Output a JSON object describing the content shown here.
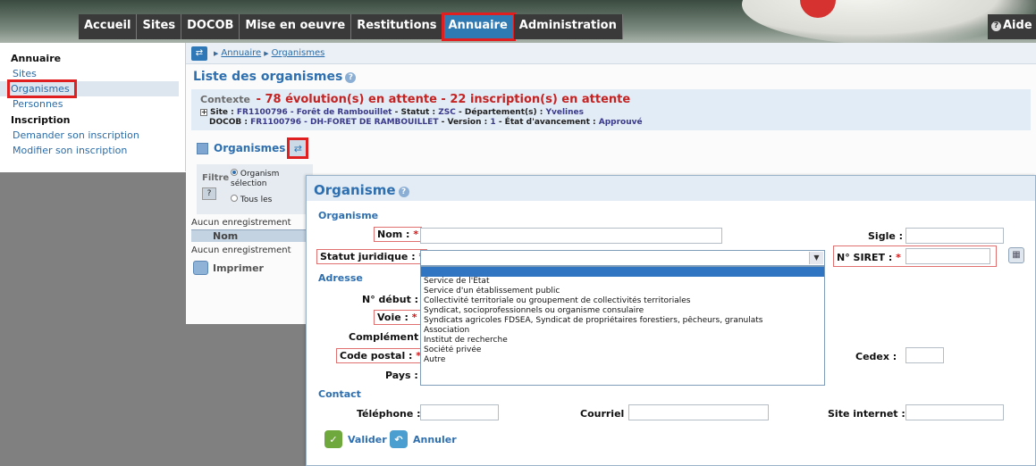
{
  "topnav": {
    "items": [
      "Accueil",
      "Sites",
      "DOCOB",
      "Mise en oeuvre",
      "Restitutions",
      "Annuaire",
      "Administration"
    ],
    "active": "Annuaire",
    "help_label": "Aide"
  },
  "sidebar": {
    "group1": "Annuaire",
    "sites": "Sites",
    "organismes": "Organismes",
    "personnes": "Personnes",
    "group2": "Inscription",
    "demander": "Demander son inscription",
    "modifier": "Modifier son inscription"
  },
  "breadcrumb": [
    "Annuaire",
    "Organismes"
  ],
  "page_title": "Liste des organismes",
  "context": {
    "label": "Contexte",
    "summary": "- 78 évolution(s) en attente - 22 inscription(s) en attente",
    "site_label": "Site :",
    "site_value": "FR1100796 - Forêt de Rambouillet",
    "statut_label": "- Statut :",
    "statut_value": "ZSC",
    "dept_label": "- Département(s) :",
    "dept_value": "Yvelines",
    "docob_label": "DOCOB :",
    "docob_value": "FR1100796 - DH-FORET DE RAMBOUILLET",
    "version_label": "- Version :",
    "version_value": "1",
    "etat_label": "- État d'avancement :",
    "etat_value": "Approuvé"
  },
  "section": {
    "title": "Organismes",
    "filter_label": "Filtre",
    "filter_opt1": "Organism sélection",
    "filter_opt2": "Tous les",
    "no_record_1": "Aucun enregistrement",
    "grid_col": "Nom",
    "no_record_2": "Aucun enregistrement",
    "print": "Imprimer"
  },
  "modal": {
    "title": "Organisme",
    "sec_organisme": "Organisme",
    "nom_label": "Nom :",
    "sigle_label": "Sigle :",
    "statut_label": "Statut juridique :",
    "siret_label": "N° SIRET :",
    "sec_adresse": "Adresse",
    "ndebut_label": "N° début :",
    "voie_label": "Voie :",
    "complement_label": "Complément :",
    "cp_label": "Code postal :",
    "cedex_label": "Cedex :",
    "pays_label": "Pays :",
    "sec_contact": "Contact",
    "tel_label": "Téléphone :",
    "courriel_label": "Courriel :",
    "site_label": "Site internet :",
    "valider": "Valider",
    "annuler": "Annuler",
    "star": "*",
    "statut_options": [
      "Service de l'État",
      "Service d'un établissement public",
      "Collectivité territoriale ou groupement de collectivités territoriales",
      "Syndicat, socioprofessionnels ou organisme consulaire",
      "Syndicats agricoles FDSEA, Syndicat de propriétaires forestiers, pêcheurs, granulats",
      "Association",
      "Institut de recherche",
      "Société privée",
      "Autre"
    ]
  }
}
